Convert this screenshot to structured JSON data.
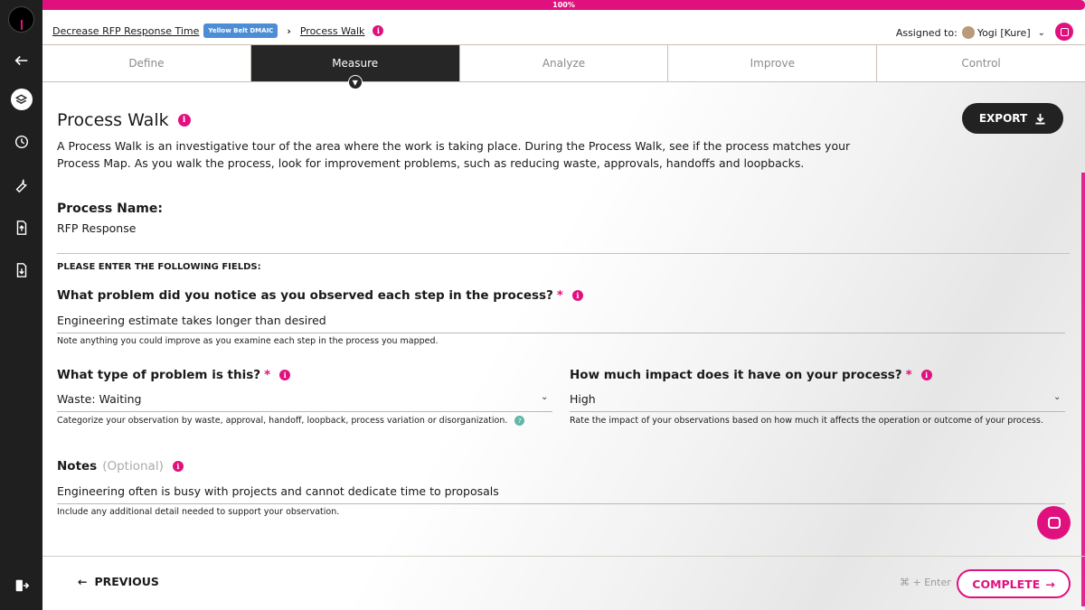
{
  "progress": {
    "label": "100%",
    "value": 1.0
  },
  "breadcrumb": {
    "project": "Decrease RFP Response Time",
    "badge": "Yellow Belt DMAIC",
    "separator": "›",
    "page": "Process Walk"
  },
  "assigned": {
    "label": "Assigned to:",
    "user": "Yogi [Kure]"
  },
  "tabs": [
    {
      "label": "Define"
    },
    {
      "label": "Measure"
    },
    {
      "label": "Analyze"
    },
    {
      "label": "Improve"
    },
    {
      "label": "Control"
    }
  ],
  "active_tab": "Measure",
  "page": {
    "title": "Process Walk",
    "export_label": "EXPORT",
    "description": "A Process Walk is an investigative tour of the area where the work is taking place. During the Process Walk, see if the process matches your Process Map. As you walk the process, look for improvement problems, such as reducing waste, approvals, handoffs and loopbacks."
  },
  "process": {
    "label": "Process Name:",
    "value": "RFP Response"
  },
  "enter_fields": "PLEASE ENTER THE FOLLOWING FIELDS:",
  "fields": {
    "problem": {
      "label": "What problem did you notice as you observed each step in the process?",
      "required": "*",
      "value": "Engineering estimate takes longer than desired",
      "hint": "Note anything you could improve as you examine each step in the process you mapped."
    },
    "type": {
      "label": "What type of problem is this?",
      "required": "*",
      "value": "Waste: Waiting",
      "hint": "Categorize your observation by waste, approval, handoff, loopback, process variation or disorganization."
    },
    "impact": {
      "label": "How much impact does it have on your process?",
      "required": "*",
      "value": "High",
      "hint": "Rate the impact of your observations based on how much it affects the operation or outcome of your process."
    },
    "notes": {
      "label": "Notes",
      "optional": "(Optional)",
      "value": "Engineering often is busy with projects and cannot dedicate time to proposals",
      "hint": "Include any additional detail needed to support your observation."
    }
  },
  "footer": {
    "previous": "PREVIOUS",
    "shortcut": "⌘ + Enter",
    "complete": "COMPLETE"
  },
  "colors": {
    "accent": "#e0117f",
    "dark": "#262626",
    "badge": "#4c8dd6"
  }
}
